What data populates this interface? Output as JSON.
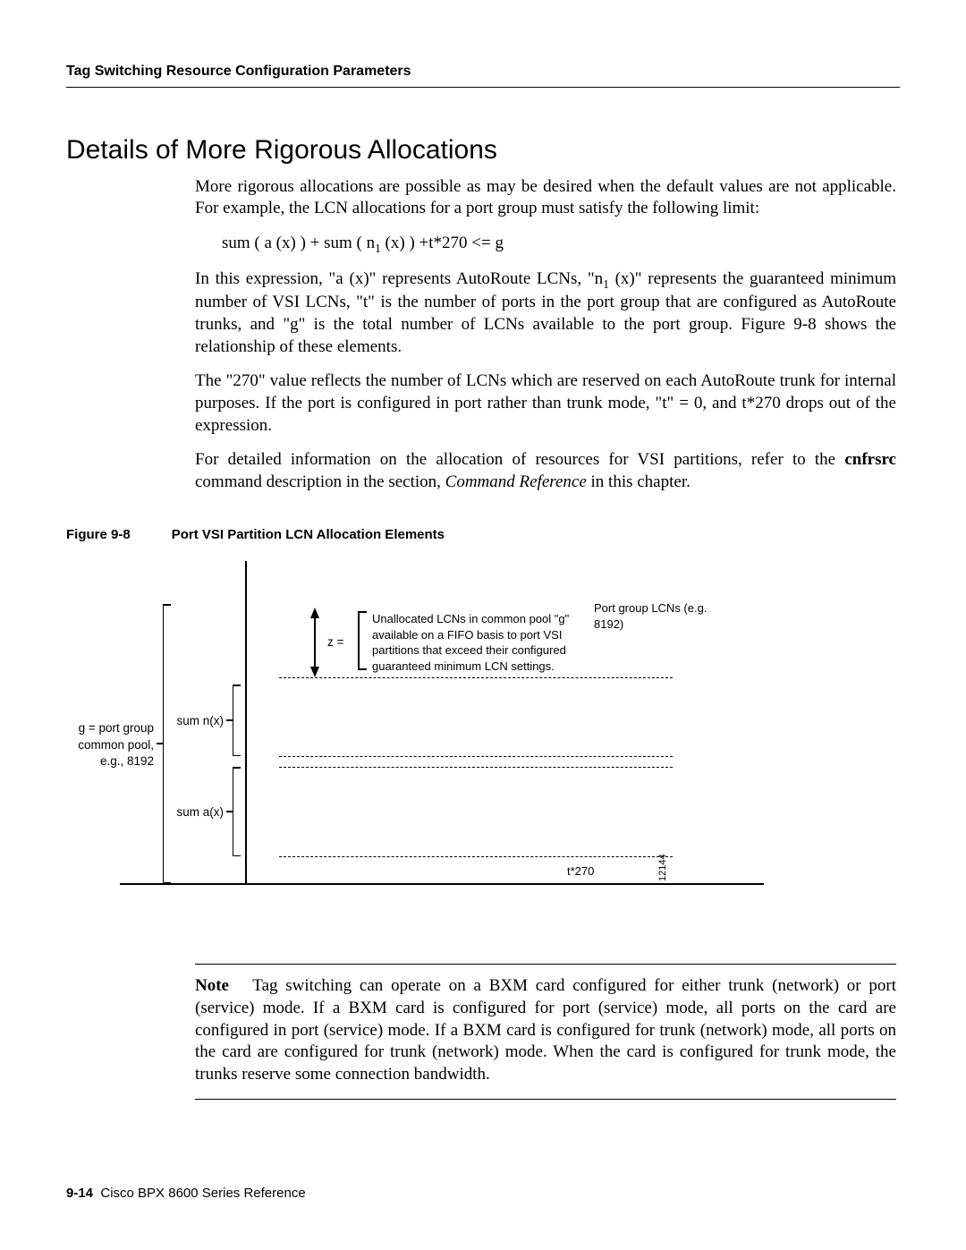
{
  "header": {
    "running": "Tag Switching Resource Configuration Parameters"
  },
  "section": {
    "title": "Details of More Rigorous Allocations",
    "p1": "More rigorous allocations are possible as may be desired when the default values are not applicable. For example, the LCN allocations for a port group must satisfy the following limit:",
    "formula_a": "sum ( a (x) ) + sum ( n",
    "formula_sub": "1",
    "formula_b": " (x) ) +t*270 <= g",
    "p2a": "In this expression, \"a (x)\" represents AutoRoute LCNs, \"n",
    "p2sub": "1",
    "p2b": " (x)\" represents the guaranteed minimum number of VSI LCNs, \"t\" is the number of ports in the port group that are configured as AutoRoute trunks, and \"g\" is the total number of LCNs available to the port group. Figure 9-8 shows the relationship of these elements.",
    "p3": "The \"270\" value reflects the number of LCNs which are reserved on each AutoRoute trunk for internal purposes. If the port is configured in port rather than trunk mode, \"t\" = 0, and t*270 drops out of the expression.",
    "p4a": "For detailed information on the allocation of resources for VSI partitions, refer to the ",
    "p4cmd": "cnfrsrc",
    "p4b": " command description in the section, ",
    "p4i": "Command Reference",
    "p4c": " in this chapter."
  },
  "figure": {
    "num": "Figure 9-8",
    "title": "Port VSI Partition LCN Allocation Elements",
    "lbl_g": "g = port group common pool, e.g., 8192",
    "lbl_sum_n": "sum n(x)",
    "lbl_sum_a": "sum a(x)",
    "lbl_z": "z =",
    "box_text": "Unallocated LCNs in common pool \"g\" available on a FIFO basis to port VSI partitions that exceed their configured guaranteed minimum LCN settings.",
    "lbl_pg": "Port group LCNs (e.g. 8192)",
    "lbl_t270": "t*270",
    "side_id": "12144"
  },
  "note": {
    "label": "Note",
    "text": "Tag switching can operate on a BXM card configured for either trunk (network) or port (service) mode. If a BXM card is configured for port (service) mode, all ports on the card are configured in port (service) mode. If a BXM card is configured for trunk (network) mode, all ports on the card are configured for trunk (network) mode.  When the card is configured for trunk mode, the trunks reserve some connection bandwidth."
  },
  "footer": {
    "page": "9-14",
    "doc": "Cisco BPX 8600 Series Reference"
  }
}
